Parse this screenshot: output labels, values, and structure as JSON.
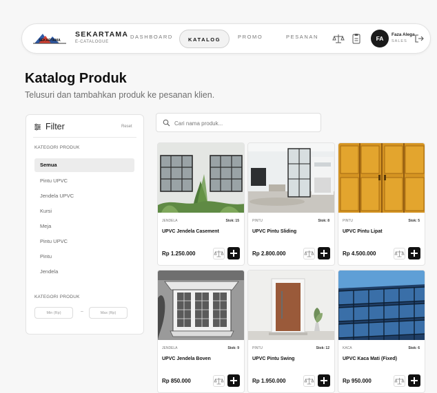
{
  "brand": {
    "name": "SEKARTAMA",
    "subtitle": "E-CATALOGUE",
    "logo_text": "SEKARTAMA"
  },
  "nav": {
    "items": [
      {
        "label": "DASHBOARD",
        "active": false
      },
      {
        "label": "KATALOG",
        "active": true
      },
      {
        "label": "PROMO",
        "active": false
      },
      {
        "label": "PESANAN",
        "active": false
      }
    ],
    "icons": [
      "compare-icon",
      "clipboard-icon"
    ]
  },
  "user": {
    "initials": "FA",
    "name": "Faza Alega",
    "role": "SALES"
  },
  "header": {
    "title": "Katalog Produk",
    "subtitle": "Telusuri dan tambahkan produk ke pesanan klien."
  },
  "filter": {
    "title": "Filter",
    "reset": "Reset",
    "category_label": "KATEGORI PRODUK",
    "categories": [
      {
        "label": "Semua",
        "active": true
      },
      {
        "label": "Pintu UPVC",
        "active": false
      },
      {
        "label": "Jendela UPVC",
        "active": false
      },
      {
        "label": "Kursi",
        "active": false
      },
      {
        "label": "Meja",
        "active": false
      },
      {
        "label": "Pintu UPVC",
        "active": false
      },
      {
        "label": "Pintu",
        "active": false
      },
      {
        "label": "Jendela",
        "active": false
      }
    ],
    "price_label": "KATEGORI PRODUK",
    "min_placeholder": "Min (Rp)",
    "separator": "–",
    "max_placeholder": "Max (Rp)"
  },
  "search": {
    "placeholder": "Cari nama produk..."
  },
  "products": [
    {
      "category": "JENDELA",
      "stock": "Stok: 15",
      "name": "UPVC Jendela Casement",
      "price": "Rp 1.250.000",
      "image": "casement-window-photo"
    },
    {
      "category": "PINTU",
      "stock": "Stok: 8",
      "name": "UPVC Pintu Sliding",
      "price": "Rp 2.800.000",
      "image": "sliding-door-photo"
    },
    {
      "category": "PINTU",
      "stock": "Stok: 5",
      "name": "UPVC Pintu Lipat",
      "price": "Rp 4.500.000",
      "image": "folding-door-photo"
    },
    {
      "category": "JENDELA",
      "stock": "Stok: 9",
      "name": "UPVC Jendela Boven",
      "price": "Rp 850.000",
      "image": "bay-window-photo"
    },
    {
      "category": "PINTU",
      "stock": "Stok: 12",
      "name": "UPVC Pintu Swing",
      "price": "Rp 1.950.000",
      "image": "swing-door-photo"
    },
    {
      "category": "KACA",
      "stock": "Stok: 6",
      "name": "UPVC Kaca Mati (Fixed)",
      "price": "Rp 950.000",
      "image": "glass-facade-photo"
    }
  ],
  "colors": {
    "accent": "#111111",
    "background": "#f7f7f7",
    "muted": "#6e6e6e"
  }
}
